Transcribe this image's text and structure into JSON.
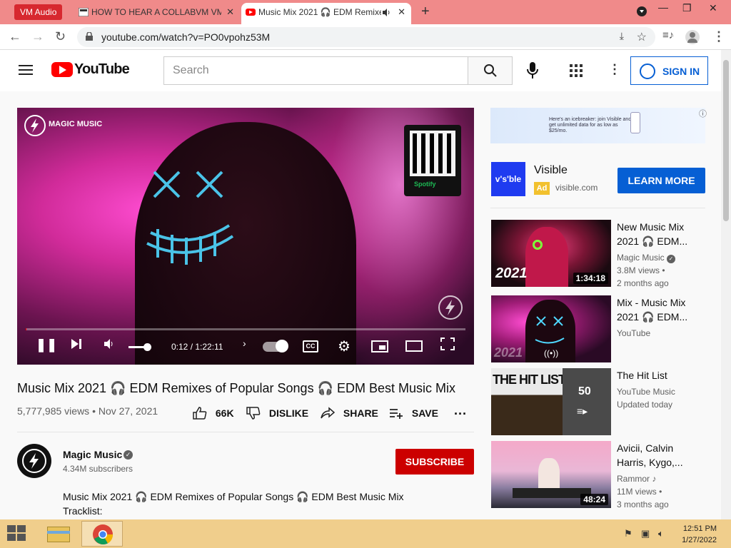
{
  "browser": {
    "vm_badge": "VM Audio",
    "tabs": [
      {
        "title": "HOW TO HEAR A COLLABVM VM",
        "close": "✕"
      },
      {
        "title": "Music Mix 2021 🎧 EDM Remixes",
        "close": "✕"
      }
    ],
    "new_tab": "+",
    "window_controls": {
      "dropdown": "⌄",
      "minimize": "—",
      "restore": "❐",
      "close": "✕"
    },
    "url": "youtube.com/watch?v=PO0vpohz53M"
  },
  "youtube": {
    "logo_text": "YouTube",
    "search_placeholder": "Search",
    "sign_in": "SIGN IN"
  },
  "player": {
    "overlay_brand": "MAGIC MUSIC",
    "qr_label": "Spotify",
    "time_current": "0:12",
    "time_total": "1:22:11",
    "time_display": "0:12 / 1:22:11",
    "cc_label": "CC",
    "progress_fraction": 0.002
  },
  "video": {
    "title": "Music Mix 2021 🎧 EDM Remixes of Popular Songs 🎧 EDM Best Music Mix",
    "views_date": "5,777,985 views • Nov 27, 2021",
    "actions": {
      "like": "66K",
      "dislike": "DISLIKE",
      "share": "SHARE",
      "save": "SAVE"
    },
    "channel": {
      "name": "Magic Music",
      "subscribers": "4.34M subscribers"
    },
    "subscribe": "SUBSCRIBE",
    "description_lines": [
      "Music Mix 2021 🎧 EDM Remixes of Popular Songs 🎧 EDM Best Music Mix",
      "Tracklist:"
    ]
  },
  "ad": {
    "banner_text": "Here's an icebreaker: join Visible and get unlimited data for as low as $25/mo.",
    "logo_text": "v's'ble",
    "name": "Visible",
    "tag": "Ad",
    "url": "visible.com",
    "cta": "LEARN MORE"
  },
  "recommendations": [
    {
      "title": "New Music Mix 2021 🎧 EDM...",
      "channel": "Magic Music",
      "meta1": "3.8M views •",
      "meta2": "2 months ago",
      "duration": "1:34:18",
      "thumb_text": "2021",
      "verified": true
    },
    {
      "title": "Mix - Music Mix 2021 🎧 EDM...",
      "channel": "YouTube",
      "meta1": "",
      "meta2": "",
      "duration": "",
      "thumb_text": "2021",
      "verified": false
    },
    {
      "title": "The Hit List",
      "channel": "YouTube Music",
      "meta1": "Updated today",
      "meta2": "",
      "duration": "",
      "thumb_text": "THE HIT LIST",
      "playlist_count": "50",
      "verified": false
    },
    {
      "title": "Avicii, Calvin Harris, Kygo,...",
      "channel": "Rammor",
      "meta1": "11M views •",
      "meta2": "3 months ago",
      "duration": "48:24",
      "thumb_text": "",
      "verified": false
    }
  ],
  "taskbar": {
    "time": "12:51 PM",
    "date": "1/27/2022"
  },
  "colors": {
    "tabstrip": "#f08a8a",
    "youtube_red": "#ff0000",
    "subscribe": "#cc0000",
    "link_blue": "#065fd4",
    "taskbar": "#f0ce8c"
  }
}
